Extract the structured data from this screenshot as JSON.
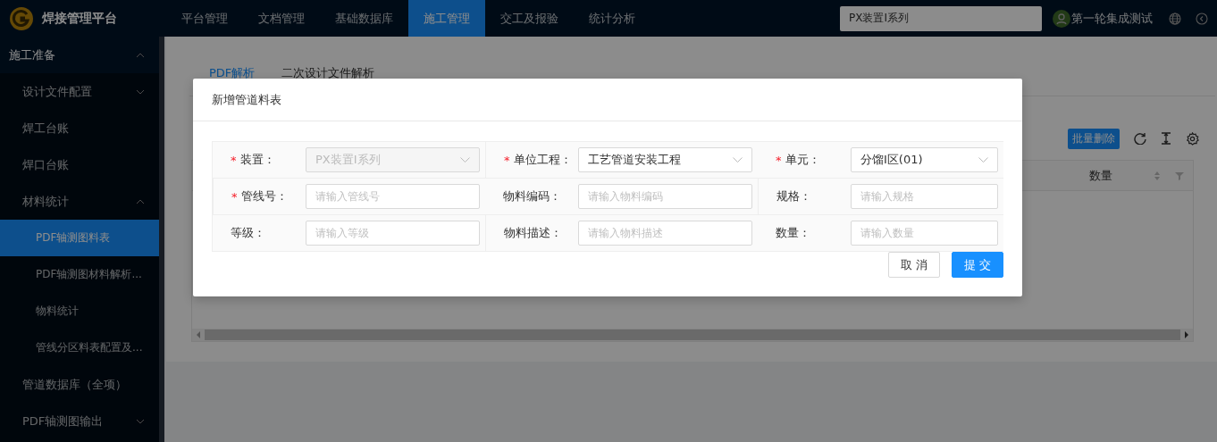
{
  "app": {
    "title": "焊接管理平台"
  },
  "top_nav": [
    {
      "label": "平台管理",
      "selected": false
    },
    {
      "label": "文档管理",
      "selected": false
    },
    {
      "label": "基础数据库",
      "selected": false
    },
    {
      "label": "施工管理",
      "selected": true
    },
    {
      "label": "交工及报验",
      "selected": false
    },
    {
      "label": "统计分析",
      "selected": false
    }
  ],
  "project_select": {
    "value": "PX装置I系列"
  },
  "user": {
    "name": "第一轮集成测试"
  },
  "sidebar": [
    {
      "label": "施工准备",
      "expanded": true,
      "selected": false,
      "children": [
        {
          "label": "设计文件配置",
          "expanded": false,
          "selected": false
        },
        {
          "label": "焊工台账",
          "selected": false
        },
        {
          "label": "焊口台账",
          "selected": false
        },
        {
          "label": "材料统计",
          "expanded": true,
          "selected": false,
          "children": [
            {
              "label": "PDF轴测图料表",
              "selected": true
            },
            {
              "label": "PDF轴测图材料解析...",
              "selected": false
            },
            {
              "label": "物料统计",
              "selected": false
            },
            {
              "label": "管线分区料表配置及...",
              "selected": false
            }
          ]
        },
        {
          "label": "管道数据库（全项）",
          "selected": false
        },
        {
          "label": "PDF轴测图输出",
          "expanded": false,
          "selected": false
        }
      ]
    }
  ],
  "page_tabs": [
    {
      "label": "PDF解析",
      "selected": true
    },
    {
      "label": "二次设计文件解析",
      "selected": false
    }
  ],
  "toolbar": {
    "batch_delete": "批量删除"
  },
  "table": {
    "columns": [
      {
        "label": "数量"
      }
    ]
  },
  "dialog": {
    "title": "新增管道料表",
    "fields": [
      {
        "label": "装置：",
        "required_mark": "*",
        "kind": "select",
        "value": "PX装置I系列",
        "disabled": true
      },
      {
        "label": "单位工程：",
        "required_mark": "*",
        "kind": "select",
        "value": "工艺管道安装工程",
        "disabled": false
      },
      {
        "label": "单元：",
        "required_mark": "*",
        "kind": "select",
        "value": "分馏Ⅰ区(01)",
        "disabled": false
      },
      {
        "label": "管线号：",
        "required_mark": "*",
        "kind": "input",
        "placeholder": "请输入管线号"
      },
      {
        "label": "物料编码：",
        "kind": "input",
        "placeholder": "请输入物料编码"
      },
      {
        "label": "规格：",
        "kind": "input",
        "placeholder": "请输入规格"
      },
      {
        "label": "等级：",
        "kind": "input",
        "placeholder": "请输入等级"
      },
      {
        "label": "物料描述：",
        "kind": "input",
        "placeholder": "请输入物料描述"
      },
      {
        "label": "数量：",
        "kind": "input",
        "placeholder": "请输入数量"
      }
    ],
    "cancel": "取 消",
    "submit": "提 交"
  }
}
